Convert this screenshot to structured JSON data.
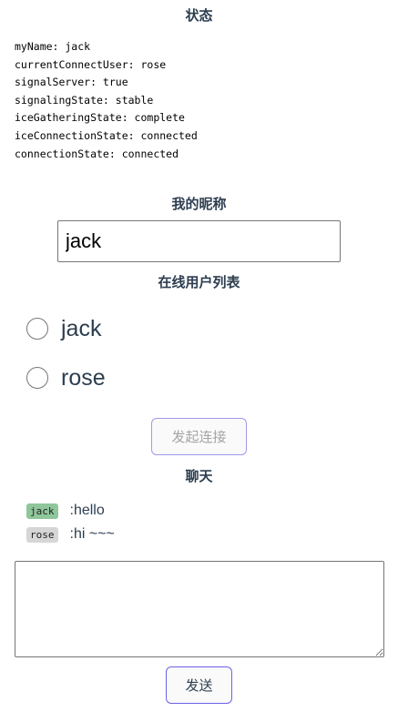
{
  "status": {
    "title": "状态",
    "lines": [
      "myName: jack",
      "currentConnectUser: rose",
      "signalServer: true",
      "signalingState: stable",
      "iceGatheringState: complete",
      "iceConnectionState: connected",
      "connectionState: connected"
    ]
  },
  "nickname": {
    "title": "我的昵称",
    "value": "jack"
  },
  "online_users": {
    "title": "在线用户列表",
    "users": [
      {
        "label": "jack",
        "checked": false
      },
      {
        "label": "rose",
        "checked": false
      }
    ],
    "connect_label": "发起连接"
  },
  "chat": {
    "title": "聊天",
    "messages": [
      {
        "user": "jack",
        "text": ":hello",
        "badge_color": "#8fc69b"
      },
      {
        "user": "rose",
        "text": ":hi ~~~",
        "badge_color": "#d6d6d6"
      }
    ],
    "input_value": "",
    "send_label": "发送"
  },
  "colors": {
    "button_border": "#6c63e8",
    "text": "#2c3e50"
  }
}
